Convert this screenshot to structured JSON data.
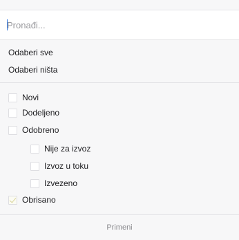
{
  "search": {
    "placeholder": "Pronađi..."
  },
  "bulk_actions": {
    "select_all": "Odaberi sve",
    "select_none": "Odaberi ništa"
  },
  "statuses": [
    {
      "label": "Novi",
      "checked": false,
      "level": 0
    },
    {
      "label": "Dodeljeno",
      "checked": false,
      "level": 0
    },
    {
      "label": "Odobreno",
      "checked": false,
      "level": 0
    },
    {
      "label": "Nije za izvoz",
      "checked": false,
      "level": 1
    },
    {
      "label": "Izvoz u toku",
      "checked": false,
      "level": 1
    },
    {
      "label": "Izvezeno",
      "checked": false,
      "level": 1
    },
    {
      "label": "Obrisano",
      "checked": true,
      "level": 0
    }
  ],
  "apply_label": "Primeni",
  "colors": {
    "checkmark": "#d9d49a",
    "caret": "#3b7de0"
  }
}
